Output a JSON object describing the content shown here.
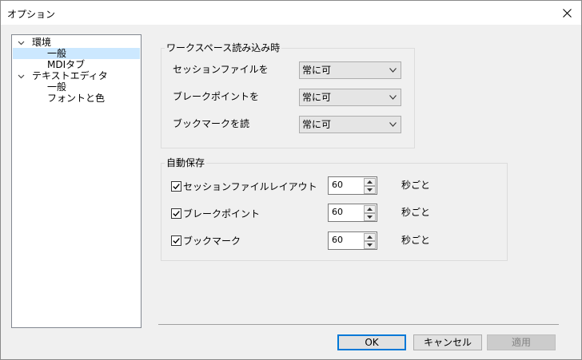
{
  "window": {
    "title": "オプション"
  },
  "tree": {
    "items": [
      {
        "label": "環境",
        "expanded": true,
        "level": 0
      },
      {
        "label": "一般",
        "selected": true,
        "level": 1
      },
      {
        "label": "MDIタブ",
        "level": 1
      },
      {
        "label": "テキストエディタ",
        "expanded": true,
        "level": 0
      },
      {
        "label": "一般",
        "level": 1
      },
      {
        "label": "フォントと色",
        "level": 1
      }
    ]
  },
  "load_group": {
    "title": "ワークスペース読み込み時",
    "rows": [
      {
        "label": "セッションファイルを",
        "value": "常に可"
      },
      {
        "label": "ブレークポイントを",
        "value": "常に可"
      },
      {
        "label": "ブックマークを読",
        "value": "常に可"
      }
    ]
  },
  "autosave_group": {
    "title": "自動保存",
    "rows": [
      {
        "label": "セッションファイルレイアウト",
        "checked": true,
        "value": "60",
        "unit": "秒ごと"
      },
      {
        "label": "ブレークポイント",
        "checked": true,
        "value": "60",
        "unit": "秒ごと"
      },
      {
        "label": "ブックマーク",
        "checked": true,
        "value": "60",
        "unit": "秒ごと"
      }
    ]
  },
  "buttons": {
    "ok": "OK",
    "cancel": "キャンセル",
    "apply": "適用"
  },
  "colors": {
    "selection": "#cce8ff",
    "default_button_border": "#0078d7"
  }
}
